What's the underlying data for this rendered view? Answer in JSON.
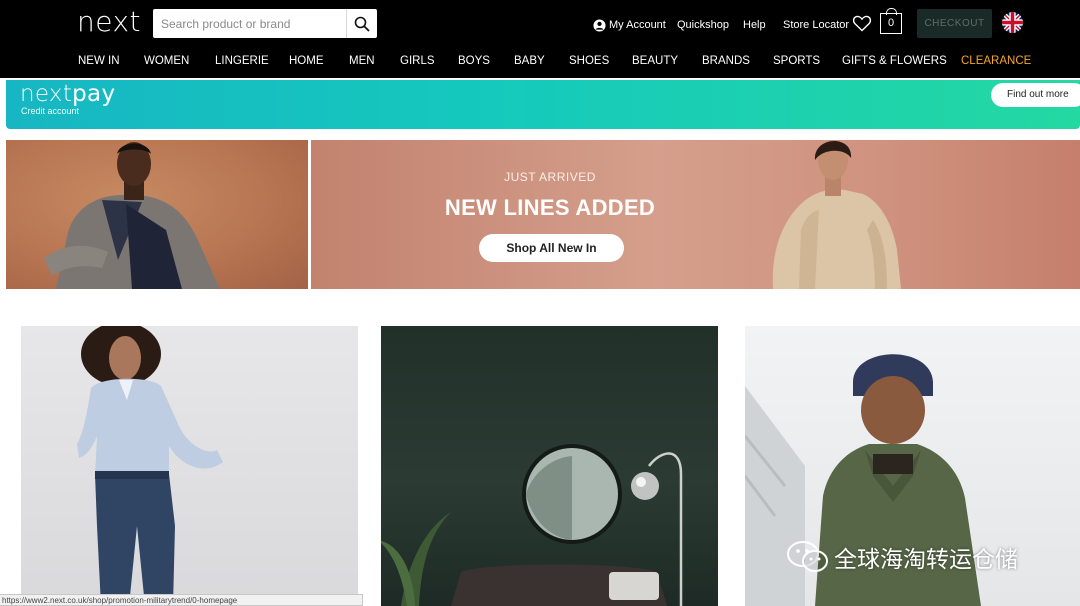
{
  "header": {
    "logo": "next",
    "search_placeholder": "Search product or brand",
    "my_account": "My Account",
    "quickshop": "Quickshop",
    "help": "Help",
    "store_locator": "Store Locator",
    "bag_count": "0",
    "checkout": "CHECKOUT"
  },
  "nav": [
    {
      "label": "NEW IN"
    },
    {
      "label": "WOMEN"
    },
    {
      "label": "LINGERIE"
    },
    {
      "label": "HOME"
    },
    {
      "label": "MEN"
    },
    {
      "label": "GIRLS"
    },
    {
      "label": "BOYS"
    },
    {
      "label": "BABY"
    },
    {
      "label": "SHOES"
    },
    {
      "label": "BEAUTY"
    },
    {
      "label": "BRANDS"
    },
    {
      "label": "SPORTS"
    },
    {
      "label": "GIFTS & FLOWERS"
    },
    {
      "label": "CLEARANCE"
    }
  ],
  "nextpay": {
    "logo_next": "next",
    "logo_pay": "pay",
    "subtitle": "Credit account",
    "button": "Find out more"
  },
  "hero": {
    "kicker": "JUST ARRIVED",
    "headline": "NEW LINES ADDED",
    "button": "Shop All New In"
  },
  "status_url": "https://www2.next.co.uk/shop/promotion-militarytrend/0-homepage",
  "watermark": "全球海淘转运仓储",
  "colors": {
    "header_bg": "#000000",
    "clearance": "#f5a623",
    "nextpay_start": "#17b6c3",
    "nextpay_end": "#24d8a2",
    "checkout_bg": "#1a2a26"
  }
}
